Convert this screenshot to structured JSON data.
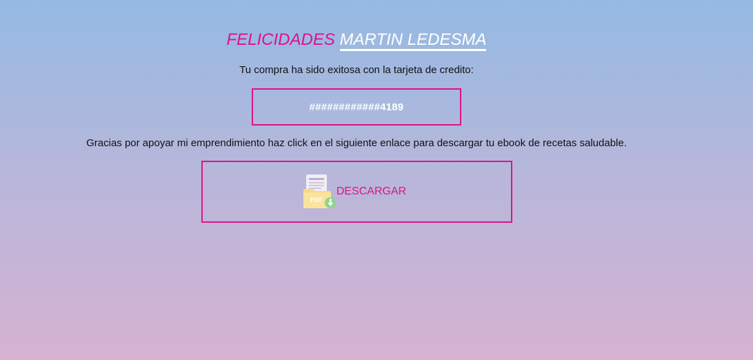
{
  "header": {
    "greeting": "FELICIDADES",
    "customer_name": "MARTIN LEDESMA"
  },
  "purchase": {
    "message": "Tu compra ha sido exitosa con la tarjeta de credito:",
    "card_number": "############4189"
  },
  "thanks": {
    "message": "Gracias por apoyar mi emprendimiento haz click en el siguiente enlace para descargar tu ebook de recetas saludable."
  },
  "download": {
    "label": "DESCARGAR",
    "icon": "pdf-download-icon",
    "icon_text": "PDF"
  },
  "colors": {
    "accent": "#e0118a",
    "name_text": "#ffffff",
    "gradient_top": "#94bae3",
    "gradient_bottom": "#d6b2d1"
  }
}
